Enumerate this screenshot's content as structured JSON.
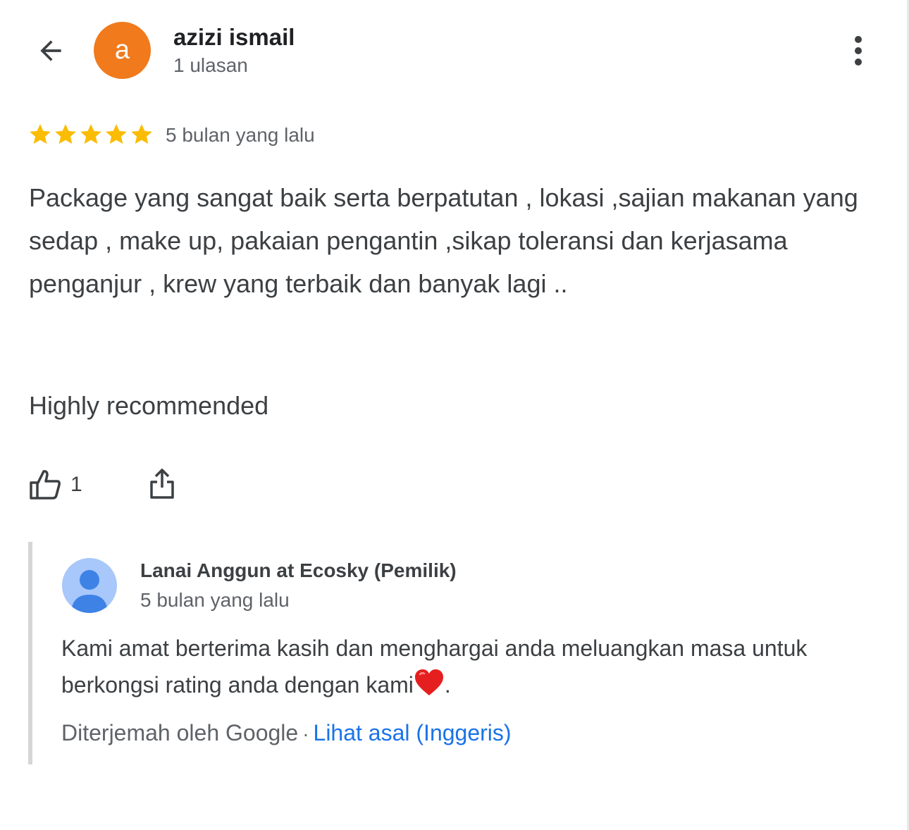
{
  "header": {
    "back_icon": "arrow-left-icon",
    "avatar_letter": "a",
    "avatar_color": "#f07a1c",
    "reviewer_name": "azizi ismail",
    "review_count": "1 ulasan",
    "more_icon": "more-vertical-icon"
  },
  "review": {
    "rating": 5,
    "max_rating": 5,
    "star_color": "#fbbc04",
    "date": "5 bulan yang lalu",
    "text": "Package yang sangat baik serta berpatutan , lokasi ,sajian makanan yang sedap , make up, pakaian pengantin ,sikap toleransi dan kerjasama penganjur , krew yang terbaik dan banyak lagi ..",
    "text_extra": "Highly recommended",
    "like_icon": "thumbs-up-icon",
    "like_count": "1",
    "share_icon": "share-icon"
  },
  "owner_reply": {
    "avatar_icon": "person-icon",
    "name": "Lanai Anggun at Ecosky (Pemilik)",
    "date": "5 bulan yang lalu",
    "text": "Kami amat berterima kasih dan menghargai anda meluangkan masa untuk berkongsi rating anda dengan kami",
    "text_suffix": ".",
    "heart_icon": "heart-emoji-icon",
    "translated_by": "Diterjemah oleh Google",
    "separator": "·",
    "original_link": "Lihat asal (Inggeris)",
    "link_color": "#1a73e8"
  }
}
